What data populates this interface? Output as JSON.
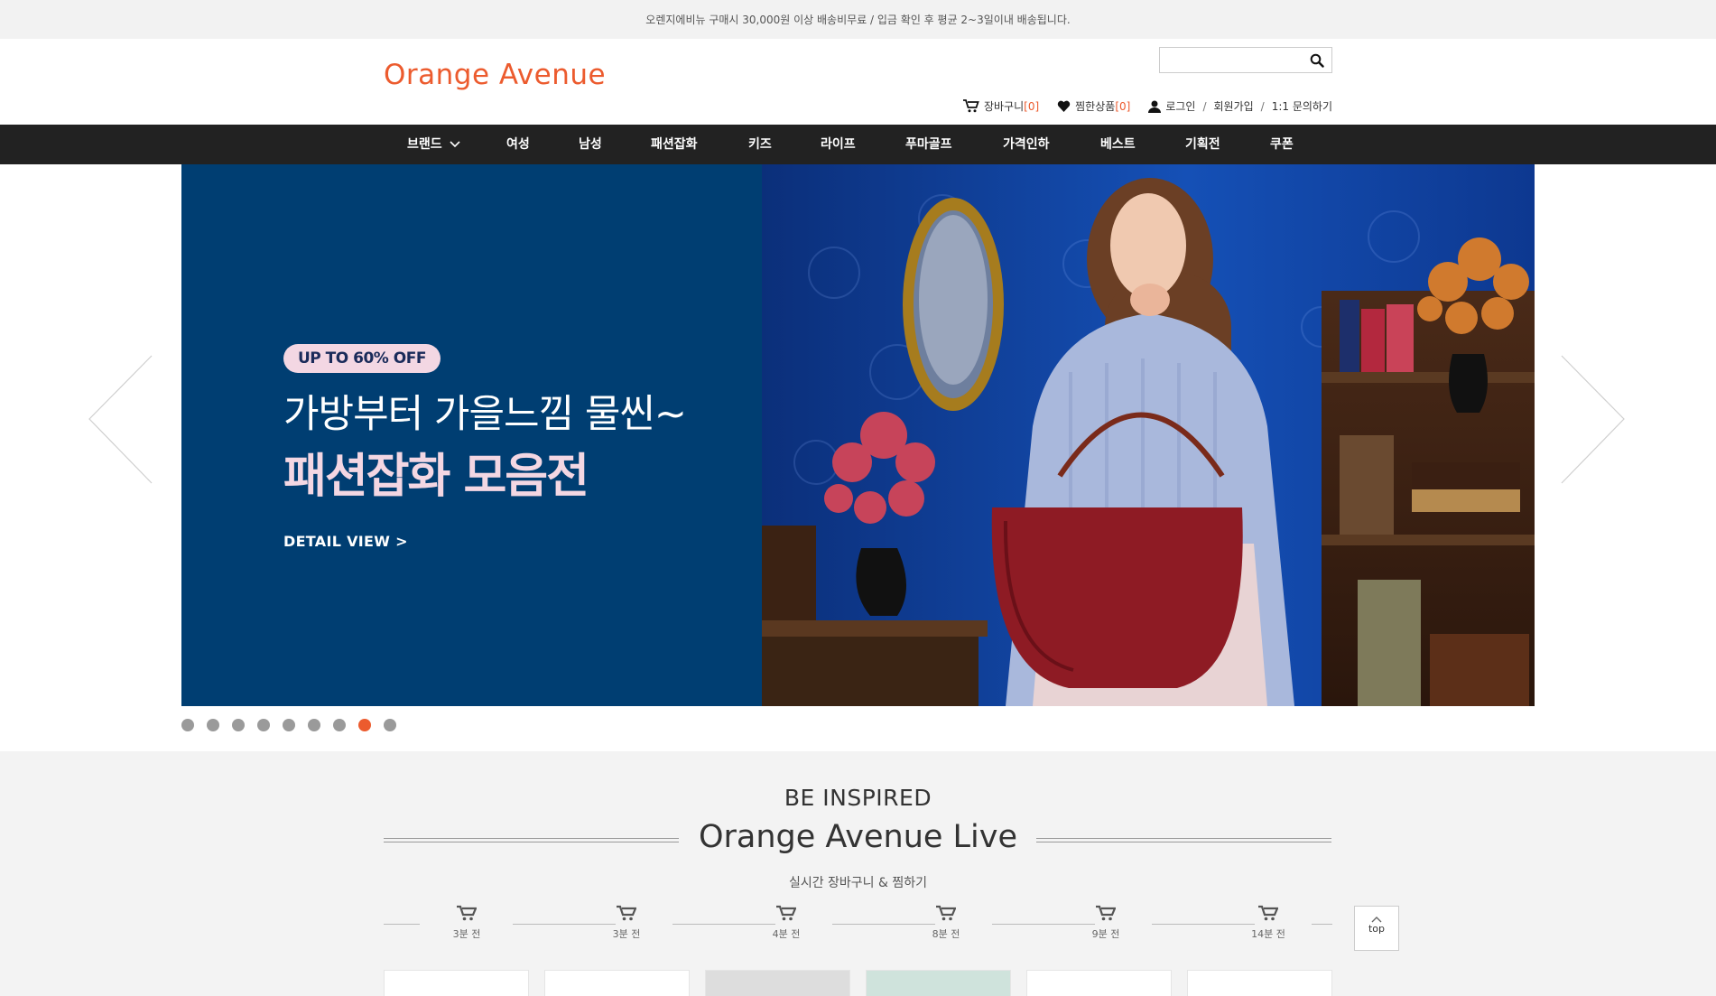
{
  "notice": "오렌지에비뉴 구매시 30,000원 이상 배송비무료 / 입금 확인 후 평균 2~3일이내 배송됩니다.",
  "header": {
    "logo": "Orange Avenue",
    "search": {
      "placeholder": "",
      "value": ""
    },
    "util": {
      "cart_label": "장바구니",
      "cart_count": "[0]",
      "wish_label": "찜한상품",
      "wish_count": "[0]",
      "login": "로그인",
      "join": "회원가입",
      "qna": "1:1 문의하기",
      "sep": "/"
    }
  },
  "gnb": [
    "브랜드",
    "여성",
    "남성",
    "패션잡화",
    "키즈",
    "라이프",
    "푸마골프",
    "가격인하",
    "베스트",
    "기획전",
    "쿠폰"
  ],
  "banner": {
    "badge": "UP TO 60% OFF",
    "headline1": "가방부터 가을느낌 물씬~",
    "headline2": "패션잡화 모음전",
    "detail": "DETAIL VIEW >",
    "dots_total": 9,
    "active_dot": 8,
    "colors": {
      "left_bg": "#003e72",
      "accent": "#ec5b2e",
      "badge_bg": "#f3d7e3"
    }
  },
  "live": {
    "eyebrow": "BE INSPIRED",
    "title": "Orange Avenue Live",
    "subtitle": "실시간 장바구니 & 찜하기",
    "times": [
      "3분 전",
      "3분 전",
      "4분 전",
      "8분 전",
      "9분 전",
      "14분 전"
    ]
  },
  "top_button": "top"
}
